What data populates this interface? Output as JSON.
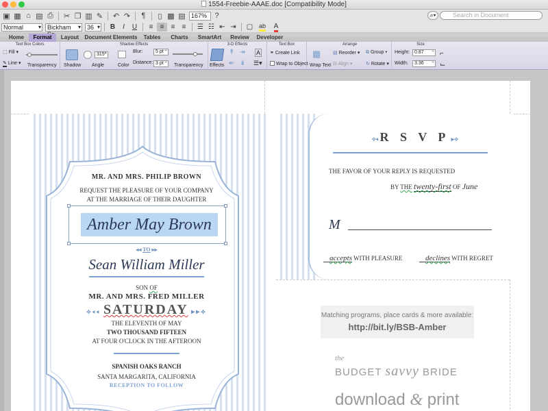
{
  "window": {
    "title": "1554-Freebie-AAAE.doc [Compatibility Mode]"
  },
  "toolbar": {
    "zoom": "167%",
    "search_placeholder": "Search in Document"
  },
  "format_bar": {
    "style": "Normal",
    "font": "Bickham Sc...",
    "size": "36"
  },
  "tabs": [
    "Home",
    "Format",
    "Layout",
    "Document Elements",
    "Tables",
    "Charts",
    "SmartArt",
    "Review",
    "Developer"
  ],
  "active_tab": "Format",
  "ribbon": {
    "groups": {
      "text_box_colors": "Text Box Colors",
      "shadow_effects": "Shadow Effects",
      "effects_3d": "3-D Effects",
      "text_box": "Text Box",
      "arrange": "Arrange",
      "size": "Size"
    },
    "fill": "Fill",
    "line": "Line",
    "transparency": "Transparency",
    "shadow": "Shadow",
    "angle": "Angle",
    "angle_value": "315°",
    "color": "Color",
    "blur": "Blur:",
    "blur_value": "5 pt",
    "distance": "Distance:",
    "distance_value": "3 pt",
    "transparency2": "Transparency",
    "effects": "Effects",
    "create_link": "Create Link",
    "wrap_to_object": "Wrap to Object",
    "wrap_text": "Wrap Text",
    "reorder": "Reorder",
    "group": "Group",
    "align": "Align",
    "rotate": "Rotate",
    "height_label": "Height:",
    "height_value": "0.87",
    "width_label": "Width:",
    "width_value": "3.36"
  },
  "invite": {
    "line1": "MR. AND MRS. PHILIP BROWN",
    "line2": "REQUEST THE PLEASURE OF YOUR COMPANY",
    "line3": "AT THE MARRIAGE OF THEIR DAUGHTER",
    "bride": "Amber May Brown",
    "to": "TO",
    "groom": "Sean William Miller",
    "son_of": "SON",
    "son_of_suffix": "OF",
    "groom_parents": "MR. AND MRS. FRED MILLER",
    "day": "SATURDAY",
    "date1": "THE ELEVENTH OF MAY",
    "date2": "TWO THOUSAND FIFTEEN",
    "time": "AT FOUR O'CLOCK IN THE AFTEROON",
    "venue": "SPANISH OAKS RANCH",
    "city": "SANTA MARGARITA, CALIFORNIA",
    "reception": "RECEPTION TO FOLLOW"
  },
  "rsvp": {
    "title": "R S V P",
    "request": "THE FAVOR OF YOUR REPLY IS REQUESTED",
    "by": "BY",
    "the": "THE",
    "date": "twenty-first",
    "of": "OF",
    "month": "June",
    "m": "M",
    "accepts": "accepts",
    "with_pleasure": "WITH PLEASURE",
    "declines": "declines",
    "with_regret": "WITH REGRET"
  },
  "promo": {
    "line1": "Matching programs, place cards & more available:",
    "url": "http://bit.ly/BSB-Amber",
    "brand_the": "the",
    "brand_budget": "BUDGET",
    "brand_savvy": "savvy",
    "brand_bride": "BRIDE",
    "download": "download",
    "amp": "&",
    "print": "print"
  },
  "colors": {
    "accent_blue": "#6f93bf",
    "highlight": "#b9d6f5",
    "ribbon_tab": "#b4a8d8"
  }
}
